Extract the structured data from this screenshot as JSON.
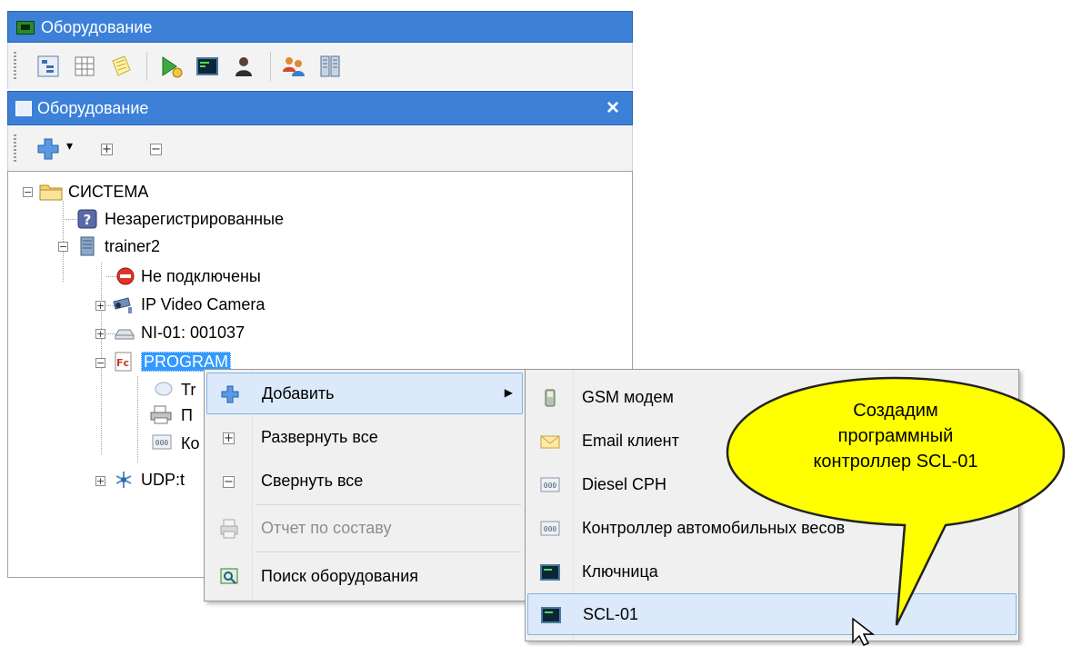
{
  "window": {
    "title": "Оборудование"
  },
  "panel": {
    "title": "Оборудование",
    "close_glyph": "×"
  },
  "toolbar": {
    "icons": [
      "tree-view-icon",
      "grid-view-icon",
      "notes-icon",
      "run-script-icon",
      "terminal-icon",
      "operator-icon",
      "users-icon",
      "config-icon"
    ]
  },
  "panel_toolbar": {
    "add_glyph": "✚",
    "dropdown_glyph": "▾",
    "expand_glyph": "+",
    "collapse_glyph": "−"
  },
  "tree": {
    "items": [
      {
        "label": "СИСТЕМА",
        "icon": "folder-icon",
        "expander": "−"
      },
      {
        "label": "Незарегистрированные",
        "icon": "question-icon"
      },
      {
        "label": "trainer2",
        "icon": "server-icon",
        "expander": "−"
      },
      {
        "label": "Не подключены",
        "icon": "no-entry-icon"
      },
      {
        "label": "IP Video Camera",
        "icon": "camera-icon",
        "expander": "+"
      },
      {
        "label": "NI-01: 001037",
        "icon": "network-device-icon",
        "expander": "+"
      },
      {
        "label": "PROGRAM",
        "icon": "program-icon",
        "expander": "−",
        "selected": true
      },
      {
        "label": "Tr",
        "icon": "chat-icon"
      },
      {
        "label": "П",
        "icon": "printer-icon"
      },
      {
        "label": "Ко",
        "icon": "controller-icon"
      },
      {
        "label": "UDP:t",
        "icon": "udp-icon",
        "expander": "+"
      }
    ]
  },
  "context_menu": {
    "items": [
      {
        "label": "Добавить",
        "icon": "add-icon",
        "submenu_arrow": "▶",
        "highlighted": true
      },
      {
        "label": "Развернуть все",
        "icon": "expand-all-icon",
        "glyph": "+"
      },
      {
        "label": "Свернуть все",
        "icon": "collapse-all-icon",
        "glyph": "−"
      },
      {
        "label": "Отчет по составу",
        "icon": "report-icon",
        "disabled": true
      },
      {
        "label": "Поиск оборудования",
        "icon": "search-equipment-icon"
      }
    ]
  },
  "submenu": {
    "items": [
      {
        "label": "GSM модем",
        "icon": "gsm-modem-icon"
      },
      {
        "label": "Email клиент",
        "icon": "email-icon"
      },
      {
        "label": "Diesel СРН",
        "icon": "controller-icon"
      },
      {
        "label": "Контроллер автомобильных весов",
        "icon": "controller-icon"
      },
      {
        "label": "Ключница",
        "icon": "keybox-icon"
      },
      {
        "label": "SCL-01",
        "icon": "scl-icon",
        "highlighted": true
      }
    ]
  },
  "callout": {
    "lines": [
      "Создадим",
      "программный",
      "контроллер SCL-01"
    ],
    "color": "#ffff00"
  },
  "colors": {
    "title_bar": "#3c80d8",
    "selection": "#3399ff",
    "menu_highlight": "#dbe9fb"
  }
}
